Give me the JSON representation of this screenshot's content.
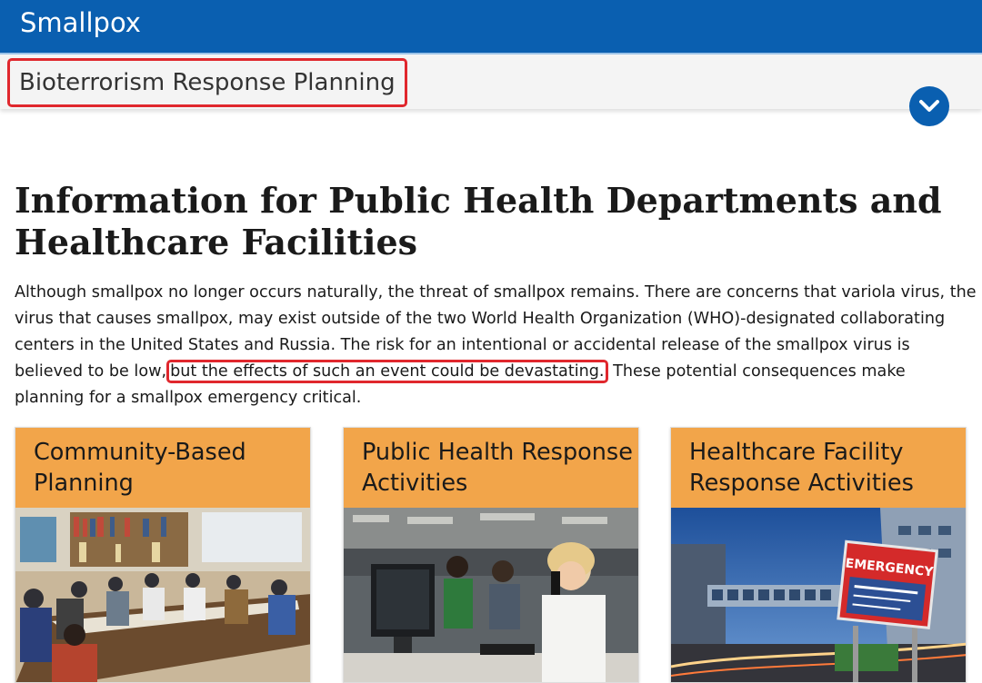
{
  "header": {
    "site_title": "Smallpox"
  },
  "subnav": {
    "breadcrumb": "Bioterrorism Response Planning",
    "expand_icon": "chevron-down-icon"
  },
  "main": {
    "heading": "Information for Public Health Departments and Healthcare Facilities",
    "paragraph_before": "Although smallpox no longer occurs naturally, the threat of smallpox remains. There are concerns that variola virus, the virus that causes smallpox, may exist outside of the two World Health Organization (WHO)-designated collaborating centers in the United States and Russia. The risk for an intentional or accidental release of the smallpox virus is believed to be low,",
    "paragraph_highlight": "but the effects of such an event could be devastating.",
    "paragraph_after": " These potential consequences make planning for a smallpox emergency critical."
  },
  "cards": [
    {
      "title": "Community-Based Planning"
    },
    {
      "title": "Public Health Response Activities"
    },
    {
      "title": "Healthcare Facility Response Activities",
      "image_sign": "EMERGENCY"
    }
  ],
  "colors": {
    "brand_blue": "#0a5fb0",
    "card_orange": "#f2a54a",
    "highlight_red": "#e0272d"
  }
}
